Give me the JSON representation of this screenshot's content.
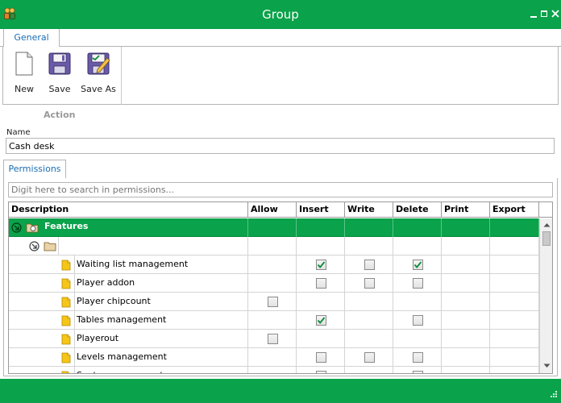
{
  "window": {
    "title": "Group",
    "controls": [
      "minimize-icon",
      "maximize-icon",
      "close-icon"
    ]
  },
  "ribbon": {
    "tabs": [
      {
        "label": "General",
        "active": true
      }
    ],
    "buttons": [
      {
        "label": "New",
        "icon": "new-document-icon"
      },
      {
        "label": "Save",
        "icon": "floppy-disk-icon"
      },
      {
        "label": "Save As",
        "icon": "floppy-save-as-icon"
      }
    ],
    "group_label": "Action"
  },
  "form": {
    "name_label": "Name",
    "name_value": "Cash desk"
  },
  "permissions": {
    "tab_label": "Permissions",
    "search_placeholder": "Digit here to search in permissions...",
    "columns": [
      "Description",
      "Allow",
      "Insert",
      "Write",
      "Delete",
      "Print",
      "Export"
    ],
    "rows": [
      {
        "label": "Features",
        "level": 0,
        "type": "group",
        "selected": true,
        "checks": {}
      },
      {
        "label": "",
        "level": 1,
        "type": "folder",
        "checks": {}
      },
      {
        "label": "Waiting list management",
        "level": 2,
        "type": "leaf",
        "checks": {
          "Insert": true,
          "Write": false,
          "Delete": true
        }
      },
      {
        "label": "Player addon",
        "level": 2,
        "type": "leaf",
        "checks": {
          "Insert": false,
          "Write": false,
          "Delete": false
        }
      },
      {
        "label": "Player chipcount",
        "level": 2,
        "type": "leaf",
        "checks": {
          "Allow": false
        }
      },
      {
        "label": "Tables management",
        "level": 2,
        "type": "leaf",
        "checks": {
          "Insert": true,
          "Delete": false
        }
      },
      {
        "label": "Playerout",
        "level": 2,
        "type": "leaf",
        "checks": {
          "Allow": false
        }
      },
      {
        "label": "Levels management",
        "level": 2,
        "type": "leaf",
        "checks": {
          "Insert": false,
          "Write": false,
          "Delete": false
        }
      },
      {
        "label": "Seats management",
        "level": 2,
        "type": "leaf",
        "checks": {
          "Insert": false,
          "Delete": false
        }
      }
    ]
  },
  "colors": {
    "accent": "#0aa24a",
    "tab_text": "#1a6db3",
    "check": "#0a8a3a"
  }
}
